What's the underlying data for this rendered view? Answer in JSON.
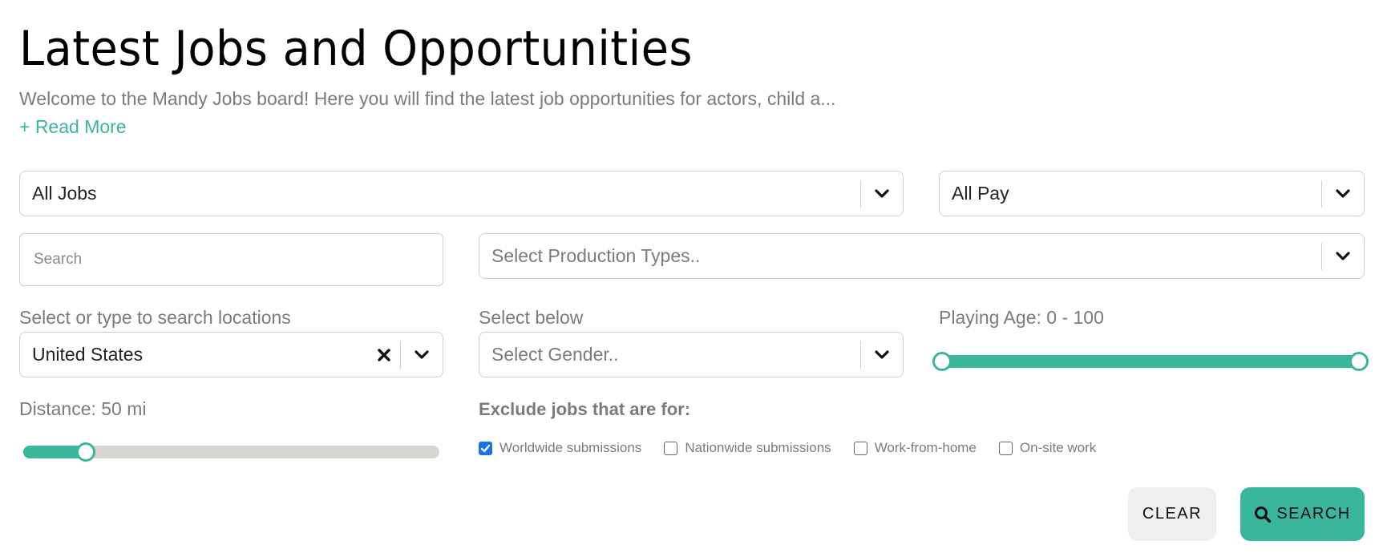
{
  "header": {
    "title": "Latest Jobs and Opportunities",
    "intro": "Welcome to the Mandy Jobs board! Here you will find the latest job opportunities for actors, child a...",
    "read_more": "+ Read More"
  },
  "filters": {
    "job_type": {
      "value": "All Jobs",
      "icon": "chevron-down-icon"
    },
    "pay": {
      "value": "All Pay",
      "icon": "chevron-down-icon"
    },
    "search": {
      "placeholder": "Search",
      "value": ""
    },
    "production_types": {
      "placeholder": "Select Production Types..",
      "icon": "chevron-down-icon"
    },
    "location": {
      "label": "Select or type to search locations",
      "value": "United States",
      "clear_icon": "close-icon",
      "icon": "chevron-down-icon"
    },
    "gender": {
      "label": "Select below",
      "placeholder": "Select Gender..",
      "icon": "chevron-down-icon"
    },
    "playing_age": {
      "label": "Playing Age: 0 - 100",
      "min": 0,
      "max": 100,
      "low": 0,
      "high": 100
    },
    "distance": {
      "label": "Distance: 50 mi",
      "value_mi": 50,
      "fill_fraction": 0.15
    },
    "exclude": {
      "heading": "Exclude jobs that are for:",
      "options": [
        {
          "label": "Worldwide submissions",
          "checked": true
        },
        {
          "label": "Nationwide submissions",
          "checked": false
        },
        {
          "label": "Work-from-home",
          "checked": false
        },
        {
          "label": "On-site work",
          "checked": false
        }
      ]
    }
  },
  "actions": {
    "clear_label": "CLEAR",
    "search_label": "SEARCH",
    "search_icon": "search-icon"
  },
  "colors": {
    "accent": "#3ab69c",
    "checkbox_checked": "#1a73e8",
    "muted_text": "#7b7b7b",
    "slider_track": "#d6d5d1",
    "clear_button_bg": "#efefef"
  }
}
